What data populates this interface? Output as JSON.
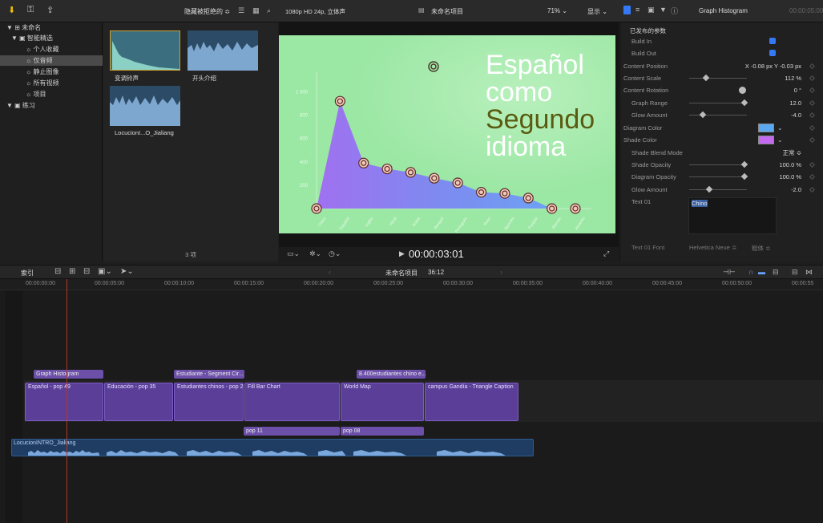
{
  "topbar": {
    "filter_label": "隐藏被拒绝的 ≎",
    "format_label": "1080p HD 24p, 立体声",
    "project_label": "未命名项目",
    "zoom": "71% ⌄",
    "display": "显示 ⌄",
    "inspector_title": "Graph Histogram",
    "inspector_time": "00:00:05:00"
  },
  "library": {
    "items": [
      {
        "label": "▼ ⊞ 未命名"
      },
      {
        "label": "▼ ▣ 智能精选"
      },
      {
        "label": "☼ 个人收藏"
      },
      {
        "label": "☼ 仅音频"
      },
      {
        "label": "☼ 静止图像"
      },
      {
        "label": "☼ 所有视频"
      },
      {
        "label": "☼ 项目"
      },
      {
        "label": "▼ ▣ 练习"
      }
    ]
  },
  "browser": {
    "clips": [
      {
        "label": "变调铃声"
      },
      {
        "label": "开头介绍"
      },
      {
        "label": "LocucionI...O_Jialiang"
      }
    ],
    "count": "3 项"
  },
  "viewer": {
    "title_line1": "Español",
    "title_line2": "como",
    "title_line3": "Segundo",
    "title_line4": "idioma",
    "timecode": "00:00:03:01",
    "y_ticks": [
      "1 000",
      "800",
      "600",
      "400",
      "200"
    ],
    "x_labels": [
      "Chino",
      "Español",
      "Inglés",
      "Hindi",
      "Árabe",
      "Bengalí",
      "Portugués",
      "Ruso",
      "Japonés",
      "Punjabí",
      "Alemán",
      "Javanés"
    ]
  },
  "chart_data": {
    "type": "area",
    "categories": [
      "Chino",
      "Español",
      "Inglés",
      "Hindi",
      "Árabe",
      "Bengalí",
      "Portugués",
      "Ruso",
      "Japonés",
      "Punjabí",
      "Alemán",
      "Javanés"
    ],
    "values": [
      0,
      920,
      390,
      340,
      310,
      260,
      220,
      140,
      130,
      90,
      0,
      0
    ],
    "ylim": [
      0,
      1100
    ]
  },
  "inspector": {
    "section": "已发布的参数",
    "rows": [
      {
        "label": "Build In",
        "value": ""
      },
      {
        "label": "Build Out",
        "value": ""
      },
      {
        "label": "Content Position",
        "value": "X   -0.08 px   Y   -0.03 px"
      },
      {
        "label": "Content Scale",
        "value": "112 %"
      },
      {
        "label": "Content Rotation",
        "value": "0 °"
      },
      {
        "label": "Graph Range",
        "value": "12.0"
      },
      {
        "label": "Glow Amount",
        "value": "-4.0"
      },
      {
        "label": "Diagram Color",
        "value": ""
      },
      {
        "label": "Shade Color",
        "value": ""
      },
      {
        "label": "Shade Blend Mode",
        "value": "正常 ≎"
      },
      {
        "label": "Shade Opacity",
        "value": "100.0 %"
      },
      {
        "label": "Diagram Opacity",
        "value": "100.0 %"
      },
      {
        "label": "Glow Amount",
        "value": "-2.0"
      },
      {
        "label": "Text 01",
        "value": ""
      }
    ],
    "text01": "Chino",
    "diagram_color": "#5aa8f0",
    "shade_color": "#c46af0",
    "bottom_label": "Text 01 Font",
    "bottom_font": "Helvetica Neue ≎",
    "bottom_weight": "粗体 ≎"
  },
  "timeline": {
    "index_label": "索引",
    "project": "未命名项目",
    "duration": "36:12",
    "ruler": [
      "00:00:00:00",
      "00:00:05:00",
      "00:00:10:00",
      "00:00:15:00",
      "00:00:20:00",
      "00:00:25:00",
      "00:00:30:00",
      "00:00:35:00",
      "00:00:40:00",
      "00:00:45:00",
      "00:00:50:00",
      "00:00:55"
    ],
    "titles": [
      {
        "label": "Graph Histogram"
      },
      {
        "label": "Estudiante - Segment Cir..."
      },
      {
        "label": "8.400estudiantes chino e..."
      }
    ],
    "clips": [
      {
        "label": "Español - pop 49"
      },
      {
        "label": "Educación - pop 35"
      },
      {
        "label": "Estudiantes chinos - pop 28"
      },
      {
        "label": "Fill Bar Chart"
      },
      {
        "label": "World Map"
      },
      {
        "label": "campus Gandía - Triangle Caption"
      }
    ],
    "subclips": [
      {
        "label": "pop 11"
      },
      {
        "label": "pop 08"
      }
    ],
    "audio": "LocucionINTRO_Jialiang"
  }
}
